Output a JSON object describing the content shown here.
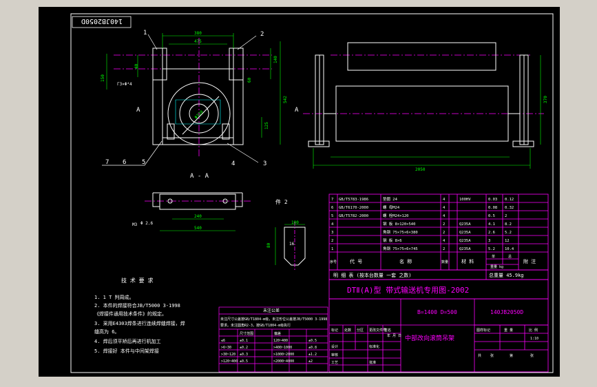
{
  "colors": {
    "outer": "#d4d0c8",
    "paper": "#000000",
    "frame": "#ffffff",
    "title_block": "#ff00ff",
    "geometry": "#ffffff",
    "center_line": "#ff00ff",
    "dimension": "#00ff00",
    "hatch": "#00ffff"
  },
  "drawing_number_rotated": "140JB2050D",
  "front_view": {
    "balloons": [
      "1",
      "2",
      "3",
      "4",
      "5",
      "6",
      "7"
    ],
    "section_mark": "A",
    "dims": {
      "top_outer": "380",
      "top_inner": "475",
      "left_a": "150",
      "left_b": "40",
      "right_a": "140",
      "right_b": "542",
      "diameter": "Φ320",
      "small_h": "125",
      "side": "60",
      "note": "Γ3×Φ⁴4"
    }
  },
  "side_view": {
    "section_mark": "A",
    "dims": {
      "bottom": "2050",
      "height": "370"
    }
  },
  "section_aa": {
    "label": "A - A",
    "dims": {
      "top": "240",
      "bottom": "540",
      "left": "Φ 2.6",
      "note": "M3"
    },
    "part_ref": "件 2"
  },
  "detail": {
    "dims": {
      "top": "100",
      "side": "80",
      "mid": "16"
    }
  },
  "tech_requirements": {
    "title": "技 术 要 求",
    "items": [
      "1. 1 T 判周成。",
      "2. 本件的焊接符合JB/T5000 3-1998",
      "   《焊接件通用技术条件》的规定。",
      "3. 采用E4303焊条进行连续焊缝焊接，焊",
      "   缝高为 6。",
      "4. 焊后须平矫后再进行机加工",
      "5. 焊接好 本件与中间架焊接"
    ]
  },
  "tolerance_table": {
    "title": "未注公差",
    "notes": [
      "未注尺寸公差按GB/T1804-m级，未注形位公差按JB/T5000 3-1998",
      "要求。未注圆角R2-3，按GB/T1804-m级执行"
    ],
    "header": [
      "",
      "尺寸范围",
      "",
      "偏差",
      "",
      ""
    ],
    "rows": [
      [
        "≤6",
        "±0.1",
        "",
        "120~400",
        "",
        "±0.5"
      ],
      [
        ">6~30",
        "±0.2",
        "",
        ">400~1000",
        "",
        "±0.8"
      ],
      [
        ">30~120",
        "±0.3",
        "",
        ">1000~2000",
        "",
        "±1.2"
      ],
      [
        ">120~400",
        "±0.5",
        "",
        ">2000~4000",
        "",
        "±2"
      ]
    ]
  },
  "bom": {
    "rows": [
      [
        "7",
        "GB/T5783-1986",
        "垫圈 24",
        "4",
        "",
        "100HV",
        "0.03",
        "0.12",
        ""
      ],
      [
        "6",
        "GB/T6170-2000",
        "螺 母M24",
        "4",
        "",
        "",
        "0.08",
        "0.32",
        ""
      ],
      [
        "5",
        "GB/T5782-2000",
        "螺 栓M24×120",
        "4",
        "",
        "",
        "0.5",
        "2",
        ""
      ],
      [
        "4",
        "",
        "钢 板 8×120×540",
        "2",
        "",
        "Q235A",
        "4.1",
        "8.2",
        ""
      ],
      [
        "3",
        "",
        "角钢 75×75×6×380",
        "2",
        "",
        "Q235A",
        "2.6",
        "5.2",
        ""
      ],
      [
        "2",
        "",
        "钢 板 8×6",
        "4",
        "",
        "Q235A",
        "3",
        "12",
        ""
      ],
      [
        "1",
        "",
        "角钢 75×75×6×745",
        "2",
        "",
        "Q235A",
        "5.2",
        "10.4",
        ""
      ]
    ],
    "header": [
      "序号",
      "代 号",
      "名 称",
      "数量",
      "",
      "材 料",
      "单",
      "总",
      "附 注"
    ],
    "header_sub": {
      "weight": "重量 kg",
      "unit": "件",
      "total": "计"
    },
    "summary": "明 细 表  (按本台数量 一套 之数)",
    "total_weight": "总重量 45.9kg"
  },
  "title_block": {
    "main_title": "DTⅡ(A)型  带式输送机专用图-2002",
    "spec": "B=1400  D=500",
    "drawing_no": "140JB2050D",
    "part_name": "中部改向滚筒吊架",
    "left_cells": [
      "标记",
      "处数",
      "分区",
      "更改文件号",
      "签名",
      "年 月 日"
    ],
    "left_rows": [
      "设计",
      "标准化",
      "审核",
      "工艺",
      "批准"
    ],
    "right_header": [
      "图样标记",
      "重 量",
      "比 例"
    ],
    "scale": "1:10",
    "sheet": [
      "共",
      "张",
      "第",
      "张"
    ]
  }
}
